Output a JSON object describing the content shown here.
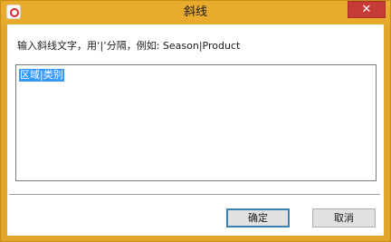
{
  "window": {
    "title": "斜线",
    "close_label": "✕",
    "app_icon": "app-logo-icon"
  },
  "dialog": {
    "prompt": "输入斜线文字，用‘|’分隔，例如: Season|Product",
    "input_value": "区域|类别"
  },
  "buttons": {
    "ok_label": "确定",
    "cancel_label": "取消"
  },
  "colors": {
    "titlebar": "#e9ab2e",
    "close_button": "#c43c35",
    "selection": "#3399ff"
  }
}
